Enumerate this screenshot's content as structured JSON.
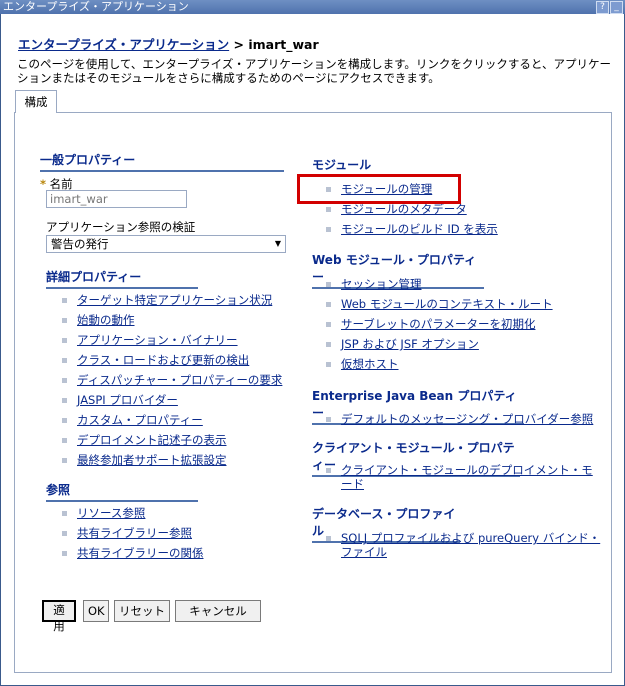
{
  "window": {
    "title": "エンタープライズ・アプリケーション",
    "help_btn": "?",
    "min_btn": "_"
  },
  "breadcrumb": {
    "link": "エンタープライズ・アプリケーション",
    "separator": ">",
    "current": "imart_war"
  },
  "description": "このページを使用して、エンタープライズ・アプリケーションを構成します。リンクをクリックすると、アプリケーションまたはそのモジュールをさらに構成するためのページにアクセスできます。",
  "tab": "構成",
  "general": {
    "title": "一般プロパティー",
    "name_label": "名前",
    "name_value": "imart_war",
    "validation_label": "アプリケーション参照の検証",
    "validation_value": "警告の発行"
  },
  "detail": {
    "title": "詳細プロパティー",
    "items": [
      "ターゲット特定アプリケーション状況",
      "始動の動作",
      "アプリケーション・バイナリー",
      "クラス・ロードおよび更新の検出",
      "ディスパッチャー・プロパティーの要求",
      "JASPI プロバイダー",
      "カスタム・プロパティー",
      "デプロイメント記述子の表示",
      "最終参加者サポート拡張設定"
    ]
  },
  "references": {
    "title": "参照",
    "items": [
      "リソース参照",
      "共有ライブラリー参照",
      "共有ライブラリーの関係"
    ]
  },
  "modules": {
    "title": "モジュール",
    "items": [
      "モジュールの管理",
      "モジュールのメタデータ",
      "モジュールのビルド ID を表示"
    ]
  },
  "web": {
    "title": "Web モジュール・プロパティー",
    "items": [
      "セッション管理",
      "Web モジュールのコンテキスト・ルート",
      "サーブレットのパラメーターを初期化",
      "JSP および JSF オプション",
      "仮想ホスト"
    ]
  },
  "ejb": {
    "title": "Enterprise Java Bean プロパティー",
    "items": [
      "デフォルトのメッセージング・プロバイダー参照"
    ]
  },
  "client": {
    "title": "クライアント・モジュール・プロパティー",
    "items": [
      "クライアント・モジュールのデプロイメント・モード"
    ]
  },
  "db": {
    "title": "データベース・プロファイル",
    "items": [
      "SQLJ プロファイルおよび pureQuery バインド・ファイル"
    ]
  },
  "buttons": {
    "apply": "適用",
    "ok": "OK",
    "reset": "リセット",
    "cancel": "キャンセル"
  }
}
